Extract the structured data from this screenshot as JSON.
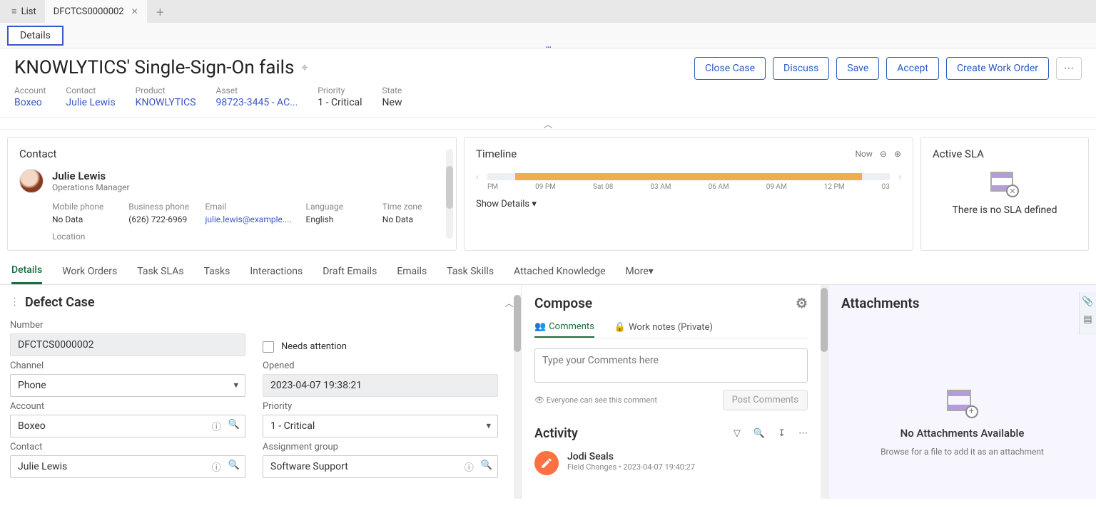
{
  "tabs": {
    "list": "List",
    "current": "DFCTCS0000002"
  },
  "subbar": {
    "details": "Details"
  },
  "header": {
    "title": "KNOWLYTICS' Single-Sign-On fails",
    "actions": {
      "close": "Close Case",
      "discuss": "Discuss",
      "save": "Save",
      "accept": "Accept",
      "cwo": "Create Work Order"
    }
  },
  "meta": {
    "account_l": "Account",
    "account_v": "Boxeo",
    "contact_l": "Contact",
    "contact_v": "Julie Lewis",
    "product_l": "Product",
    "product_v": "KNOWLYTICS",
    "asset_l": "Asset",
    "asset_v": "98723-3445 - AC...",
    "priority_l": "Priority",
    "priority_v": "1 - Critical",
    "state_l": "State",
    "state_v": "New"
  },
  "contact": {
    "title": "Contact",
    "name": "Julie Lewis",
    "role": "Operations Manager",
    "mobile_l": "Mobile phone",
    "mobile_v": "No Data",
    "biz_l": "Business phone",
    "biz_v": "(626) 722-6969",
    "email_l": "Email",
    "email_v": "julie.lewis@example....",
    "lang_l": "Language",
    "lang_v": "English",
    "tz_l": "Time zone",
    "tz_v": "No Data",
    "loc_l": "Location"
  },
  "timeline": {
    "title": "Timeline",
    "now": "Now",
    "show_details": "Show Details",
    "ticks": [
      "PM",
      "09 PM",
      "Sat 08",
      "03 AM",
      "06 AM",
      "09 AM",
      "12 PM",
      "03"
    ]
  },
  "sla": {
    "title": "Active SLA",
    "empty": "There is no SLA defined"
  },
  "secondTabs": [
    "Details",
    "Work Orders",
    "Task SLAs",
    "Tasks",
    "Interactions",
    "Draft Emails",
    "Emails",
    "Task Skills",
    "Attached Knowledge"
  ],
  "secondTabsMore": "More",
  "form": {
    "title": "Defect Case",
    "number_l": "Number",
    "number_v": "DFCTCS0000002",
    "needs_attention": "Needs attention",
    "channel_l": "Channel",
    "channel_v": "Phone",
    "opened_l": "Opened",
    "opened_v": "2023-04-07 19:38:21",
    "account_l": "Account",
    "account_v": "Boxeo",
    "priority_l": "Priority",
    "priority_v": "1 - Critical",
    "contact_l": "Contact",
    "contact_v": "Julie Lewis",
    "assign_l": "Assignment group",
    "assign_v": "Software Support"
  },
  "compose": {
    "title": "Compose",
    "tab_comments": "Comments",
    "tab_worknotes": "Work notes (Private)",
    "placeholder": "Type your Comments here",
    "visibility": "Everyone can see this comment",
    "post": "Post Comments"
  },
  "activity": {
    "title": "Activity",
    "name": "Jodi Seals",
    "sub": "Field Changes • 2023-04-07 19:40:27"
  },
  "attachments": {
    "title": "Attachments",
    "empty": "No Attachments Available",
    "hint": "Browse for a file to add it as an attachment"
  }
}
